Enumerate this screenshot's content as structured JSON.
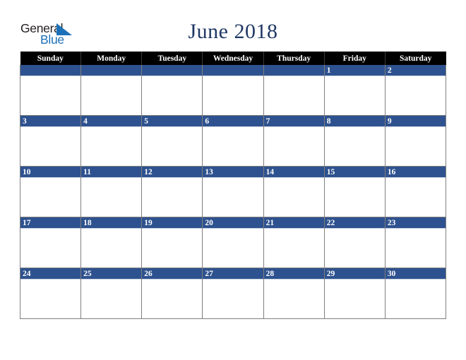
{
  "brand": {
    "name_part1": "General",
    "name_part2": "Blue",
    "logo_primary_color": "#1d71b8",
    "logo_text_color": "#231f20"
  },
  "header": {
    "title": "June 2018",
    "title_color": "#1f3864"
  },
  "calendar": {
    "month": "June",
    "year": "2018",
    "header_background": "#000000",
    "date_bar_color": "#2e528f",
    "grid_line_color": "#7f7f7f",
    "weekday_headers": [
      "Sunday",
      "Monday",
      "Tuesday",
      "Wednesday",
      "Thursday",
      "Friday",
      "Saturday"
    ],
    "weeks": [
      [
        "",
        "",
        "",
        "",
        "",
        "1",
        "2"
      ],
      [
        "3",
        "4",
        "5",
        "6",
        "7",
        "8",
        "9"
      ],
      [
        "10",
        "11",
        "12",
        "13",
        "14",
        "15",
        "16"
      ],
      [
        "17",
        "18",
        "19",
        "20",
        "21",
        "22",
        "23"
      ],
      [
        "24",
        "25",
        "26",
        "27",
        "28",
        "29",
        "30"
      ]
    ]
  }
}
